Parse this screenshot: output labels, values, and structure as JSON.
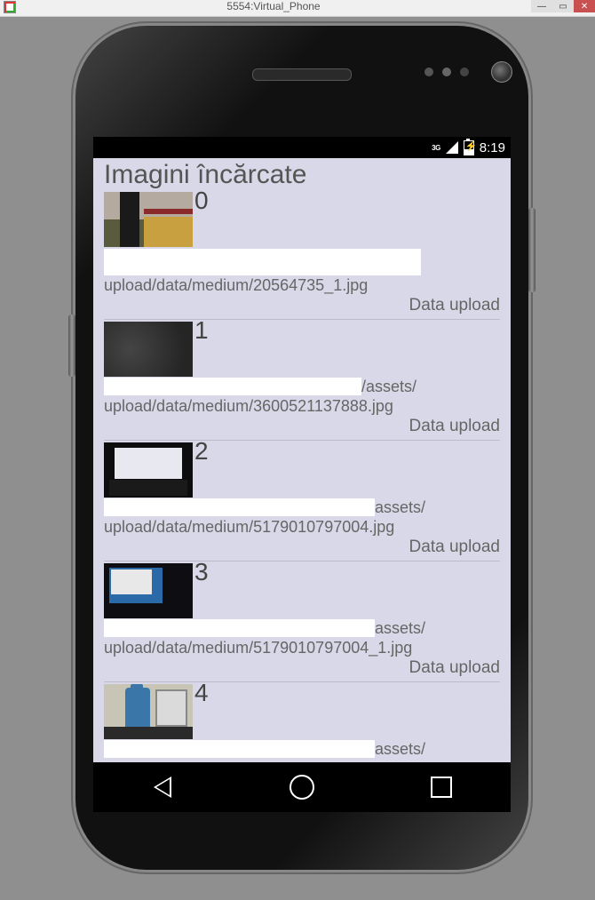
{
  "host": {
    "title": "5554:Virtual_Phone"
  },
  "statusbar": {
    "network_label": "3G",
    "time": "8:19"
  },
  "app": {
    "title": "Imagini încărcate",
    "upload_tag": "Data upload",
    "items": [
      {
        "index": "0",
        "path": "upload/data/medium/20564735_1.jpg",
        "path_prefix": "",
        "path_suffix": ""
      },
      {
        "index": "1",
        "path_prefix": "",
        "path_mid": "/assets/",
        "path": "upload/data/medium/3600521137888.jpg"
      },
      {
        "index": "2",
        "path_prefix": "",
        "path_mid": "assets/",
        "path": "upload/data/medium/5179010797004.jpg"
      },
      {
        "index": "3",
        "path_prefix": "",
        "path_mid": "assets/",
        "path": "upload/data/medium/5179010797004_1.jpg"
      },
      {
        "index": "4",
        "path_prefix": "",
        "path_mid": "assets/",
        "path": ""
      }
    ]
  },
  "nav": {
    "back": "back",
    "home": "home",
    "recent": "recent"
  }
}
